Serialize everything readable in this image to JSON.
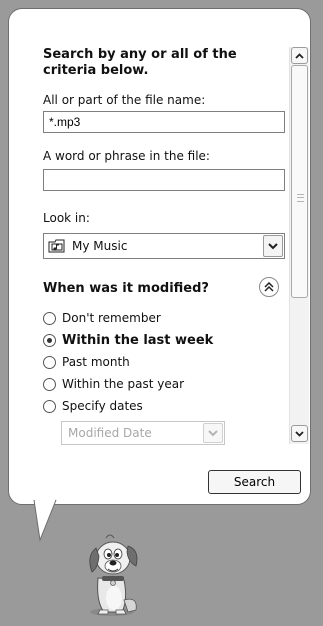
{
  "panel": {
    "heading": "Search by any or all of the criteria below.",
    "filename_label": "All or part of the file name:",
    "filename_value": "*.mp3",
    "phrase_label": "A word or phrase in the file:",
    "phrase_value": "",
    "lookin_label": "Look in:",
    "lookin_value": "My Music",
    "modified_title": "When was it modified?",
    "options": [
      {
        "label": "Don't remember",
        "checked": false
      },
      {
        "label": "Within the last week",
        "checked": true
      },
      {
        "label": "Past month",
        "checked": false
      },
      {
        "label": "Within the past year",
        "checked": false
      },
      {
        "label": "Specify dates",
        "checked": false
      }
    ],
    "date_dropdown": "Modified Date",
    "search_button": "Search"
  },
  "icons": {
    "lookin": "folder-music-icon",
    "character": "search-companion-dog"
  },
  "colors": {
    "background": "#9a9a9a",
    "panel": "#ffffff",
    "disabled_text": "#a8a8a8"
  }
}
